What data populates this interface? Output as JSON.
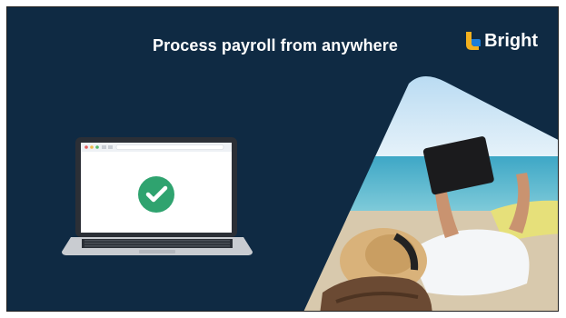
{
  "slide": {
    "title": "Process payroll from anywhere",
    "brand_name": "Bright"
  },
  "colors": {
    "background": "#0f2a43",
    "check_green": "#2fa36f",
    "brand_blue": "#1c7dd8",
    "brand_yellow": "#f2b01e"
  },
  "icons": {
    "brand_logo": "bright-logo-icon",
    "check": "check-circle-icon"
  }
}
